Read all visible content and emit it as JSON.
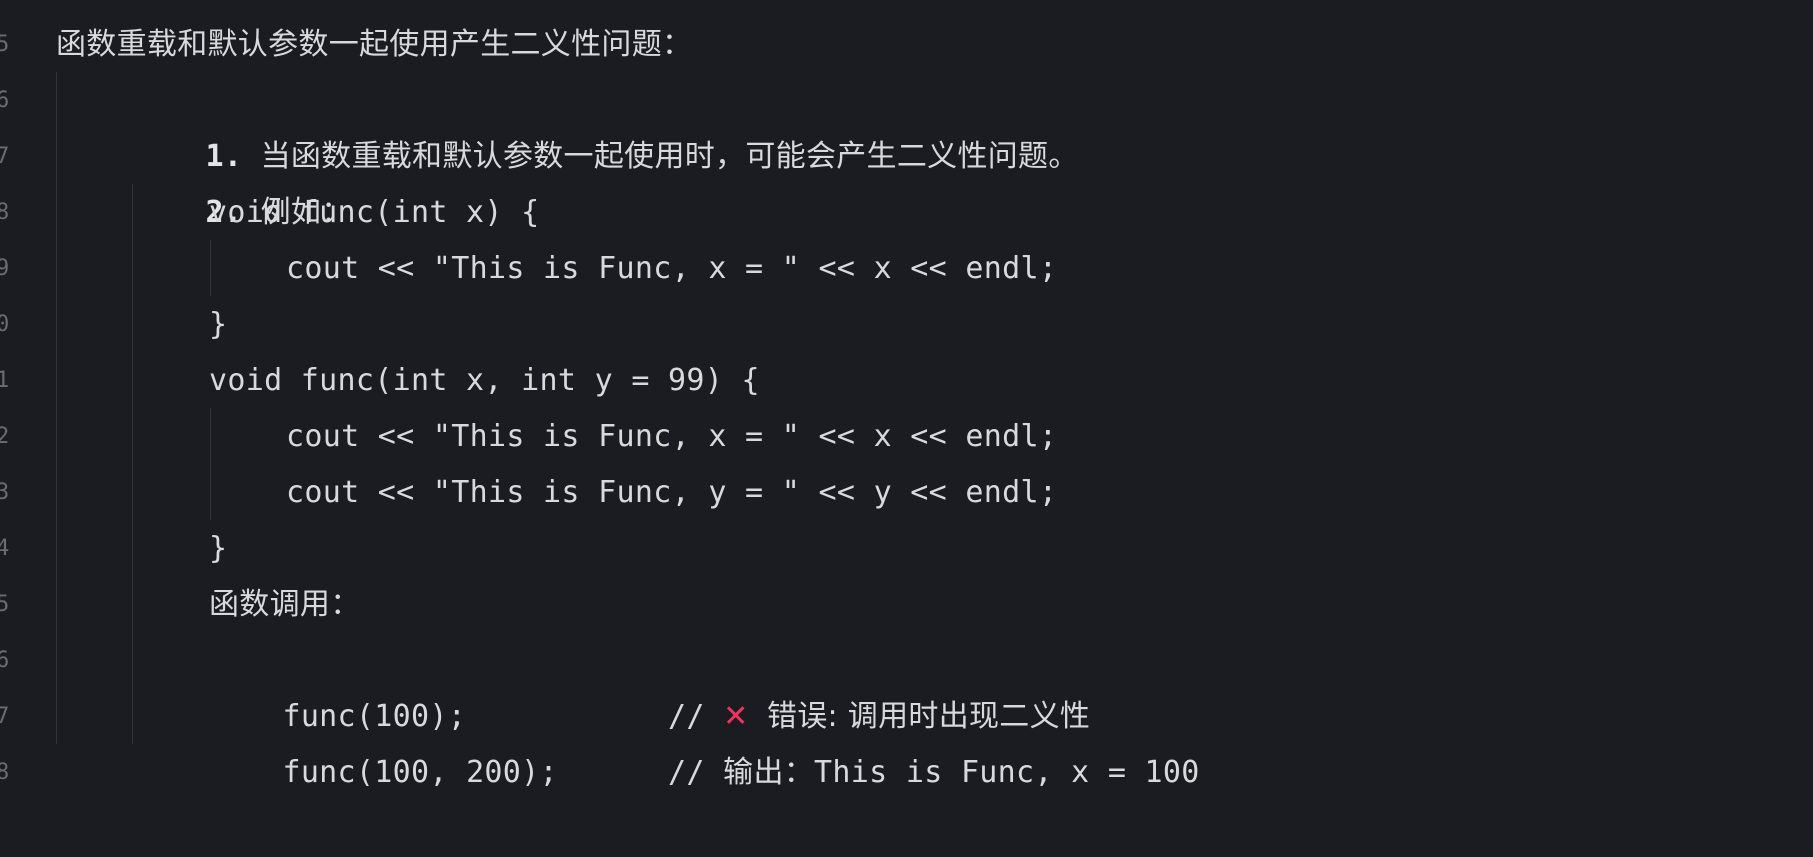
{
  "gutter": {
    "numbers": [
      "5",
      "6",
      "7",
      "8",
      "9",
      "0",
      "1",
      "2",
      "3",
      "4",
      "5",
      "6",
      "7",
      "8"
    ]
  },
  "heading": "函数重载和默认参数一起使用产生二义性问题：",
  "list": [
    {
      "marker": "1.",
      "text": "当函数重载和默认参数一起使用时，可能会产生二义性问题。"
    },
    {
      "marker": "2.",
      "text": "例如："
    }
  ],
  "code": {
    "line1": "void func(int x) {",
    "line2": "cout << \"This is Func, x = \" << x << endl;",
    "line3": "}",
    "line4": "void func(int x, int y = 99) {",
    "line5": "cout << \"This is Func, x = \" << x << endl;",
    "line6": "cout << \"This is Func, y = \" << y << endl;",
    "line7": "}",
    "call_label": "函数调用：",
    "call1_code": "func(100);           // ",
    "call1_icon": "✕",
    "call1_comment": "错误: 调用时出现二义性",
    "call2_code": "func(100, 200);      // ",
    "call2_comment_cjk": "输出：",
    "call2_comment_rest": "This is Func, x = 100"
  },
  "colors": {
    "background": "#1b1c21",
    "text": "#d8d9dc",
    "error_icon": "#f0355e",
    "guide": "#33353c"
  }
}
